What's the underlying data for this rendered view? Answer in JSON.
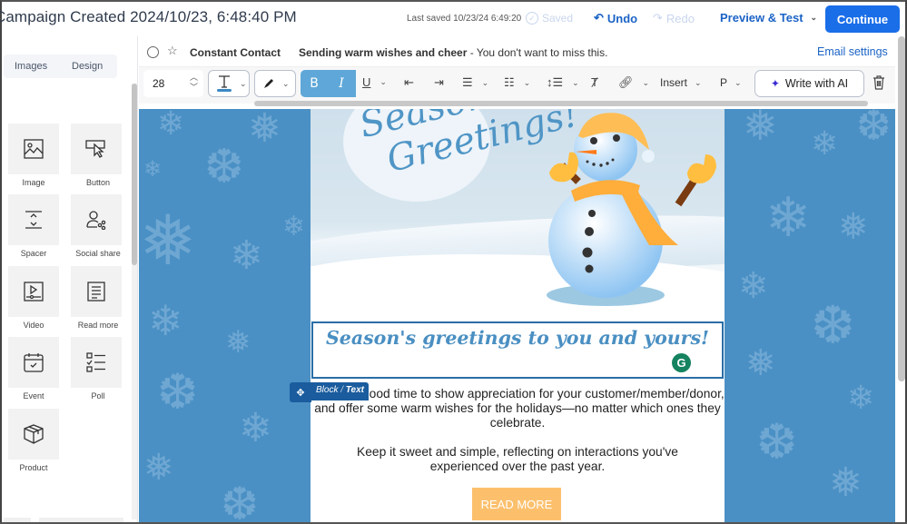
{
  "header": {
    "campaign_title": "Campaign Created 2024/10/23, 6:48:40 PM",
    "last_saved": "Last saved 10/23/24 6:49:20",
    "saved_label": "Saved",
    "undo_label": "Undo",
    "redo_label": "Redo",
    "preview_label": "Preview & Test",
    "continue_label": "Continue"
  },
  "sidebar": {
    "tabs": [
      {
        "label": "Images"
      },
      {
        "label": "Design"
      }
    ],
    "blocks": [
      {
        "label": "Image",
        "icon": "image-icon"
      },
      {
        "label": "Button",
        "icon": "button-cursor-icon"
      },
      {
        "label": "Spacer",
        "icon": "spacer-icon"
      },
      {
        "label": "Social share",
        "icon": "social-share-icon"
      },
      {
        "label": "Video",
        "icon": "video-icon"
      },
      {
        "label": "Read more",
        "icon": "read-more-icon"
      },
      {
        "label": "Event",
        "icon": "calendar-icon"
      },
      {
        "label": "Poll",
        "icon": "poll-icon"
      },
      {
        "label": "Product",
        "icon": "product-box-icon"
      }
    ]
  },
  "subject_row": {
    "sender": "Constant Contact",
    "subject_bold": "Sending warm wishes and cheer",
    "subject_rest": " - You don't want to miss this.",
    "email_settings_label": "Email settings"
  },
  "toolbar": {
    "font_size": "28",
    "bold_label": "B",
    "italic_label": "I",
    "insert_label": "Insert",
    "paragraph_label": "P",
    "write_ai_label": "Write with AI",
    "text_color": "#4a8fc2"
  },
  "email": {
    "hero_text_line1": "Season's",
    "hero_text_line2": "Greetings!",
    "block_tag_block": "Block",
    "block_tag_sep": " / ",
    "block_tag_type": "Text",
    "heading": "Season's greetings to you and yours!",
    "paragraph1": "Now is a good time to show appreciation for your customer/member/donor, and offer some warm wishes for the holidays—no matter which ones they celebrate.",
    "paragraph2": "Keep it sweet and simple, reflecting on interactions you've experienced over the past year.",
    "button_label": "READ MORE",
    "grammarly_label": "G"
  },
  "colors": {
    "primary": "#1a6ee8",
    "link": "#1b63c6",
    "canvas_bg": "#4a90c4",
    "heading": "#4a8fc2",
    "button": "#fcc06d",
    "selection": "#2a6ea6"
  }
}
